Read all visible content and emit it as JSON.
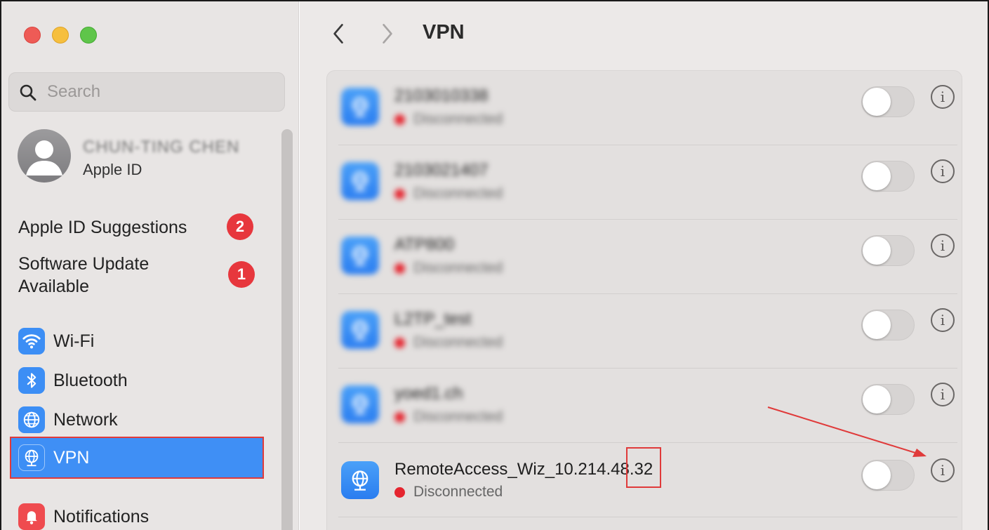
{
  "window": {
    "title": "VPN"
  },
  "sidebar": {
    "search_placeholder": "Search",
    "account": {
      "name": "CHUN-TING CHEN",
      "subtitle": "Apple ID"
    },
    "suggestions": [
      {
        "label": "Apple ID Suggestions",
        "badge": "2"
      },
      {
        "label_line1": "Software Update",
        "label_line2": "Available",
        "badge": "1"
      }
    ],
    "items": [
      {
        "label": "Wi-Fi",
        "icon": "wifi-icon",
        "color": "#3c8ef5"
      },
      {
        "label": "Bluetooth",
        "icon": "bluetooth-icon",
        "color": "#3c8ef5"
      },
      {
        "label": "Network",
        "icon": "globe-icon",
        "color": "#3c8ef5"
      },
      {
        "label": "VPN",
        "icon": "vpn-globe-icon",
        "color": "#3c8ef5",
        "selected": true
      },
      {
        "label": "Notifications",
        "icon": "bell-icon",
        "color": "#ef4b4f"
      }
    ]
  },
  "header": {
    "title": "VPN",
    "back_icon": "chevron-left-icon",
    "forward_icon": "chevron-right-icon"
  },
  "vpn_list": [
    {
      "name": "2103010338",
      "status": "Disconnected",
      "enabled": false,
      "blurred": true
    },
    {
      "name": "2103021407",
      "status": "Disconnected",
      "enabled": false,
      "blurred": true
    },
    {
      "name": "ATP800",
      "status": "Disconnected",
      "enabled": false,
      "blurred": true
    },
    {
      "name": "L2TP_test",
      "status": "Disconnected",
      "enabled": false,
      "blurred": true
    },
    {
      "name": "yoed1.ch",
      "status": "Disconnected",
      "enabled": false,
      "blurred": true
    },
    {
      "name": "RemoteAccess_Wiz_10.214.48.32",
      "status": "Disconnected",
      "enabled": false,
      "blurred": false
    }
  ],
  "colors": {
    "accent": "#3f8ff5",
    "status_disconnected": "#e5252f",
    "annotation": "#e03a3a"
  }
}
